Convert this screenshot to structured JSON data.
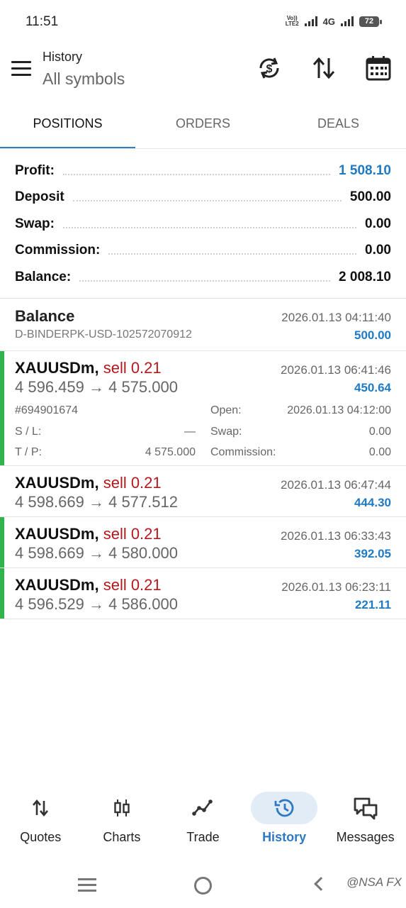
{
  "status_bar": {
    "time": "11:51",
    "volte": "Vo)) LTE2",
    "network": "4G",
    "battery": "72"
  },
  "app_bar": {
    "title": "History",
    "subtitle": "All symbols",
    "actions": [
      "currency-refresh-icon",
      "sort-icon",
      "calendar-icon"
    ]
  },
  "tabs": [
    {
      "label": "POSITIONS",
      "active": true
    },
    {
      "label": "ORDERS",
      "active": false
    },
    {
      "label": "DEALS",
      "active": false
    }
  ],
  "summary": [
    {
      "label": "Profit:",
      "value": "1 508.10",
      "highlight": true
    },
    {
      "label": "Deposit",
      "value": "500.00"
    },
    {
      "label": "Swap:",
      "value": "0.00"
    },
    {
      "label": "Commission:",
      "value": "0.00"
    },
    {
      "label": "Balance:",
      "value": "2 008.10"
    }
  ],
  "balance_entry": {
    "title": "Balance",
    "comment": "D-BINDERPK-USD-102572070912",
    "time": "2026.01.13 04:11:40",
    "amount": "500.00"
  },
  "positions": [
    {
      "symbol": "XAUUSDm,",
      "side": "sell 0.21",
      "prices": "4 596.459 → 4 575.000",
      "time": "2026.01.13 06:41:46",
      "profit": "450.64",
      "expanded": true,
      "details": {
        "ticket": "#694901674",
        "sl_label": "S / L:",
        "sl_value": "—",
        "tp_label": "T / P:",
        "tp_value": "4 575.000",
        "open_label": "Open:",
        "open_value": "2026.01.13 04:12:00",
        "swap_label": "Swap:",
        "swap_value": "0.00",
        "commission_label": "Commission:",
        "commission_value": "0.00"
      }
    },
    {
      "symbol": "XAUUSDm,",
      "side": "sell 0.21",
      "prices": "4 598.669 → 4 577.512",
      "time": "2026.01.13 06:47:44",
      "profit": "444.30",
      "marker": false
    },
    {
      "symbol": "XAUUSDm,",
      "side": "sell 0.21",
      "prices": "4 598.669 → 4 580.000",
      "time": "2026.01.13 06:33:43",
      "profit": "392.05",
      "marker": true
    },
    {
      "symbol": "XAUUSDm,",
      "side": "sell 0.21",
      "prices": "4 596.529 → 4 586.000",
      "time": "2026.01.13 06:23:11",
      "profit": "221.11",
      "marker": true
    }
  ],
  "bottom_nav": [
    {
      "label": "Quotes",
      "icon": "quotes-arrows-icon",
      "active": false
    },
    {
      "label": "Charts",
      "icon": "candlestick-icon",
      "active": false
    },
    {
      "label": "Trade",
      "icon": "trade-line-icon",
      "active": false
    },
    {
      "label": "History",
      "icon": "history-icon",
      "active": true
    },
    {
      "label": "Messages",
      "icon": "messages-icon",
      "active": false
    }
  ],
  "watermark": "@NSA FX",
  "colors": {
    "accent": "#2f7fc0",
    "profit": "#1f7ac2",
    "sell": "#b3181c",
    "win_marker": "#2fb34a"
  }
}
